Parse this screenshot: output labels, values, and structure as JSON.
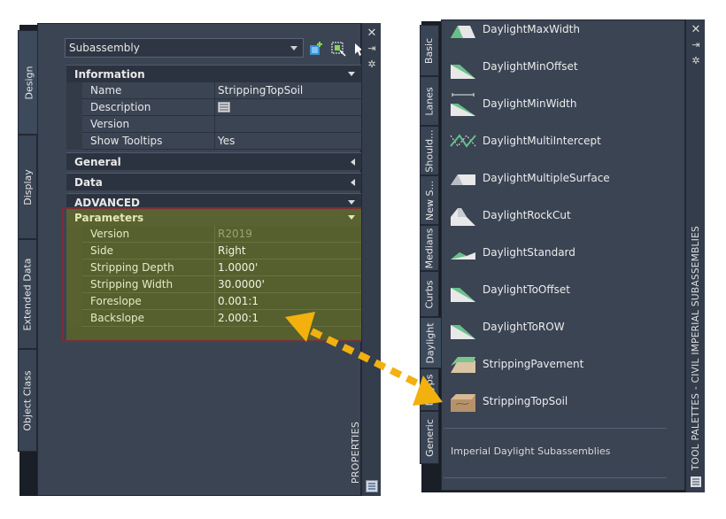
{
  "properties": {
    "tabs": [
      "Design",
      "Display",
      "Extended Data",
      "Object Class"
    ],
    "combo_value": "Subassembly",
    "title": "PROPERTIES",
    "sections": {
      "information": "Information",
      "general": "General",
      "data": "Data",
      "advanced": "ADVANCED",
      "parameters": "Parameters"
    },
    "info_rows": [
      {
        "name": "Name",
        "value": "StrippingTopSoil"
      },
      {
        "name": "Description",
        "value": ""
      },
      {
        "name": "Version",
        "value": ""
      },
      {
        "name": "Show Tooltips",
        "value": "Yes"
      }
    ],
    "param_rows": [
      {
        "name": "Version",
        "value": "R2019"
      },
      {
        "name": "Side",
        "value": "Right"
      },
      {
        "name": "Stripping Depth",
        "value": "1.0000'"
      },
      {
        "name": "Stripping Width",
        "value": "30.0000'"
      },
      {
        "name": "Foreslope",
        "value": "0.001:1"
      },
      {
        "name": "Backslope",
        "value": "2.000:1"
      }
    ]
  },
  "tool_palette": {
    "title": "TOOL PALETTES - CIVIL IMPERIAL SUBASSEMBLIES",
    "tabs": [
      "Basic",
      "Lanes",
      "Should...",
      "New S...",
      "Medians",
      "Curbs",
      "Daylight",
      "L...yps",
      "Generic"
    ],
    "tools": [
      "DaylightMaxWidth",
      "DaylightMinOffset",
      "DaylightMinWidth",
      "DaylightMultiIntercept",
      "DaylightMultipleSurface",
      "DaylightRockCut",
      "DaylightStandard",
      "DaylightToOffset",
      "DaylightToROW",
      "StrippingPavement",
      "StrippingTopSoil"
    ],
    "footer": "Imperial Daylight Subassemblies"
  },
  "colors": {
    "panel": "#3b4453",
    "highlight": "#55602e",
    "highlight_border": "#7a2f36",
    "arrow": "#f2b10e"
  }
}
